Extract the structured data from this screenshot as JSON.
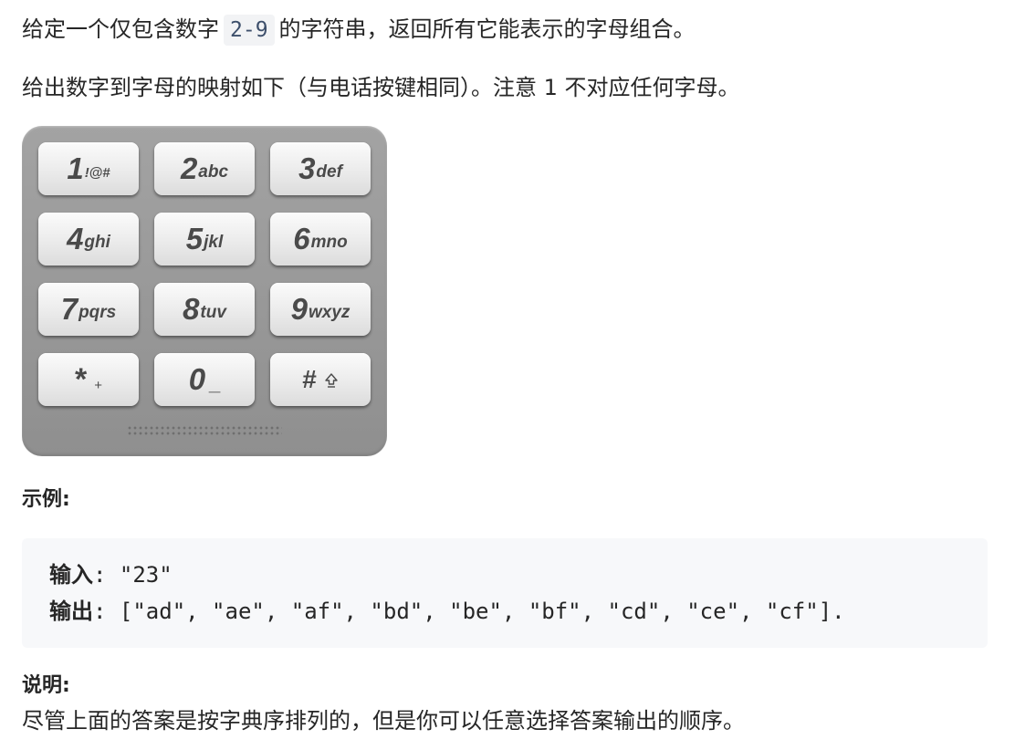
{
  "intro": {
    "text_before": "给定一个仅包含数字",
    "code": "2-9",
    "text_after": "的字符串，返回所有它能表示的字母组合。"
  },
  "mapping_note": "给出数字到字母的映射如下（与电话按键相同）。注意 1 不对应任何字母。",
  "keypad": {
    "keys": [
      {
        "digit": "1",
        "letters": "!@#"
      },
      {
        "digit": "2",
        "letters": "abc"
      },
      {
        "digit": "3",
        "letters": "def"
      },
      {
        "digit": "4",
        "letters": "ghi"
      },
      {
        "digit": "5",
        "letters": "jkl"
      },
      {
        "digit": "6",
        "letters": "mno"
      },
      {
        "digit": "7",
        "letters": "pqrs"
      },
      {
        "digit": "8",
        "letters": "tuv"
      },
      {
        "digit": "9",
        "letters": "wxyz"
      },
      {
        "digit": "*",
        "letters": "+"
      },
      {
        "digit": "0",
        "letters": "_"
      },
      {
        "digit": "#",
        "letters": "",
        "icon": "shift-icon"
      }
    ]
  },
  "example": {
    "heading": "示例:",
    "input_label": "输入",
    "input_value": ": \"23\"",
    "output_label": "输出",
    "output_value": ": [\"ad\", \"ae\", \"af\", \"bd\", \"be\", \"bf\", \"cd\", \"ce\", \"cf\"]."
  },
  "explanation": {
    "heading": "说明:",
    "text": "尽管上面的答案是按字典序排列的，但是你可以任意选择答案输出的顺序。"
  }
}
